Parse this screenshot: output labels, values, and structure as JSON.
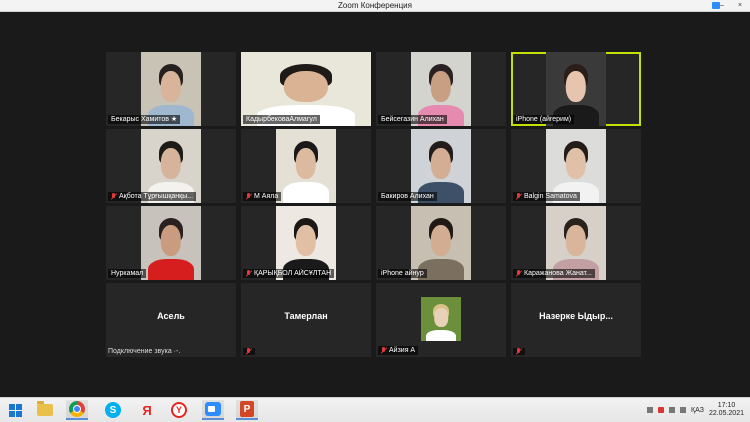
{
  "window": {
    "title": "Zoom Конференция"
  },
  "participants": [
    {
      "name": "Бекарыс Хамитов ★",
      "muted": false,
      "active": false,
      "bg": "#c9c3b6",
      "skin": "#d7b49a",
      "hair": "#262120",
      "shirt": "#9fb7cf",
      "video": true
    },
    {
      "name": "КадырбековаАлмагул",
      "muted": false,
      "active": false,
      "bg": "#e9e6da",
      "skin": "#d9b393",
      "hair": "#1d1a18",
      "shirt": "#ffffff",
      "video": true
    },
    {
      "name": "Бейсегазин Алихан",
      "muted": false,
      "active": false,
      "bg": "#d4d4cf",
      "skin": "#c99f84",
      "hair": "#2a2222",
      "shirt": "#e68ab0",
      "video": true
    },
    {
      "name": "iPhone (айгерим)",
      "muted": false,
      "active": true,
      "bg": "#3a3a3a",
      "skin": "#e6c4ad",
      "hair": "#2a1e1a",
      "shirt": "#1a1a1a",
      "video": true
    },
    {
      "name": "Ақбота Тұрғышқанқы...",
      "muted": true,
      "active": false,
      "bg": "#d8d3cb",
      "skin": "#d6b39b",
      "hair": "#1e1a18",
      "shirt": "#f4f2ef",
      "video": true
    },
    {
      "name": "М Аяла",
      "muted": true,
      "active": false,
      "bg": "#e5e0d5",
      "skin": "#dcbaa0",
      "hair": "#1a1818",
      "shirt": "#ffffff",
      "video": true
    },
    {
      "name": "Бакиров Алихан",
      "muted": false,
      "active": false,
      "bg": "#cfd2d6",
      "skin": "#d4ae94",
      "hair": "#221d1b",
      "shirt": "#3d5068",
      "video": true
    },
    {
      "name": "Balgin Samatova",
      "muted": true,
      "active": false,
      "bg": "#dcdcda",
      "skin": "#e0c0a6",
      "hair": "#231c18",
      "shirt": "#f2f2f2",
      "video": true
    },
    {
      "name": "Нуркамал",
      "muted": false,
      "active": false,
      "bg": "#c7c2bb",
      "skin": "#c99c80",
      "hair": "#2b2020",
      "shirt": "#d61e1e",
      "video": true
    },
    {
      "name": "ҚАРЫҚБОЛ АЙСҰЛТАН",
      "muted": true,
      "active": false,
      "bg": "#ede9e2",
      "skin": "#e0bfa5",
      "hair": "#1b1717",
      "shirt": "#1a1a1a",
      "video": true
    },
    {
      "name": "iPhone айнур",
      "muted": false,
      "active": false,
      "bg": "#c7c0b2",
      "skin": "#d2ad91",
      "hair": "#201916",
      "shirt": "#7b6f5f",
      "video": true
    },
    {
      "name": "Каражанова Жанат...",
      "muted": true,
      "active": false,
      "bg": "#d6d0c8",
      "skin": "#d8b59b",
      "hair": "#2a211d",
      "shirt": "#c29fa2",
      "video": true
    },
    {
      "name": "Асель",
      "audio_note": "Подключение звука ·-.",
      "muted": false,
      "active": false,
      "video": false
    },
    {
      "name": "Тамерлан",
      "muted": true,
      "active": false,
      "video": false
    },
    {
      "name": "Айзия А",
      "muted": true,
      "active": false,
      "video": "photo",
      "bg": "#6b8f3a",
      "skin": "#e8d0b9",
      "hair": "#d9c28a",
      "shirt": "#ffffff"
    },
    {
      "name": "Назерке Ыдыр...",
      "muted": true,
      "active": false,
      "video": false
    }
  ],
  "taskbar": {
    "items": [
      "start-menu",
      "file-explorer",
      "chrome",
      "skype",
      "yandex",
      "yandex-browser",
      "zoom",
      "powerpoint"
    ],
    "language": "ҚАЗ",
    "time": "17:10",
    "date": "22.05.2021"
  }
}
